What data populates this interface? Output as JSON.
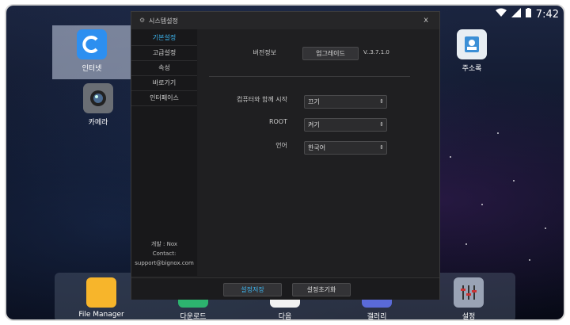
{
  "status": {
    "time": "7:42",
    "wifi_icon": "wifi-icon",
    "signal_icon": "signal-icon",
    "battery_icon": "battery-icon"
  },
  "desktop": {
    "icons": [
      {
        "label": "인터넷"
      },
      {
        "label": "카메라"
      },
      {
        "label": "주소록"
      }
    ],
    "dock": [
      {
        "label": "File Manager"
      },
      {
        "label": "다운로드"
      },
      {
        "label": "다음"
      },
      {
        "label": "갤러리"
      },
      {
        "label": "설정"
      }
    ]
  },
  "dialog": {
    "title": "시스템설정",
    "close": "x",
    "sidebar": [
      {
        "label": "기본설정",
        "active": true
      },
      {
        "label": "고급설정"
      },
      {
        "label": "속성"
      },
      {
        "label": "바로가기"
      },
      {
        "label": "인터페이스"
      }
    ],
    "footer_lines": [
      "개발 : Nox",
      "Contact:",
      "support@bignox.com"
    ],
    "version_label": "버전정보",
    "upgrade_button": "업그레이드",
    "version_value": "V..3.7.1.0",
    "boot_label": "컴퓨터와 함께 시작",
    "boot_value": "끄기",
    "root_label": "ROOT",
    "root_value": "켜기",
    "lang_label": "언어",
    "lang_value": "한국어",
    "save_button": "설정저장",
    "reset_button": "설정초기화",
    "accent": "#3db7f2"
  }
}
